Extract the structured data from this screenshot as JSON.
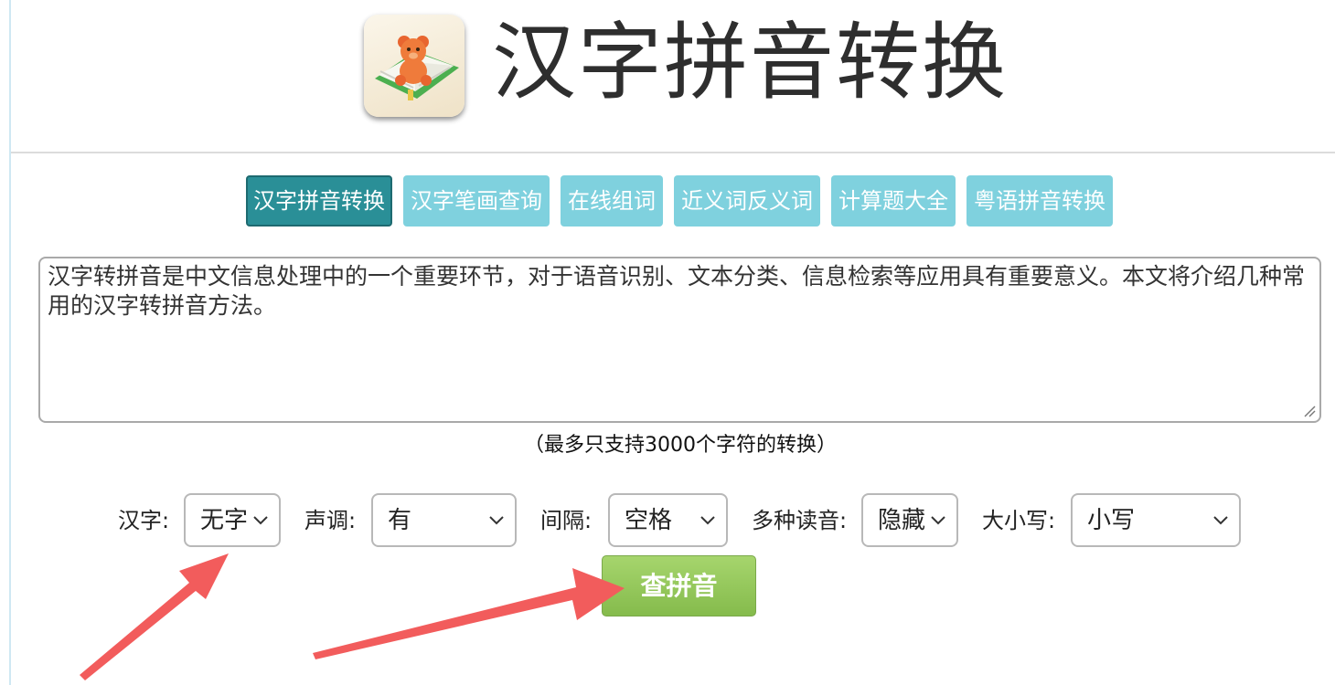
{
  "header": {
    "title": "汉字拼音转换",
    "logo_icon": "teddy-bear-book-logo"
  },
  "nav": {
    "items": [
      {
        "label": "汉字拼音转换",
        "active": true
      },
      {
        "label": "汉字笔画查询",
        "active": false
      },
      {
        "label": "在线组词",
        "active": false
      },
      {
        "label": "近义词反义词",
        "active": false
      },
      {
        "label": "计算题大全",
        "active": false
      },
      {
        "label": "粤语拼音转换",
        "active": false
      }
    ]
  },
  "input": {
    "value": "汉字转拼音是中文信息处理中的一个重要环节，对于语音识别、文本分类、信息检索等应用具有重要意义。本文将介绍几种常用的汉字转拼音方法。"
  },
  "hint": "（最多只支持3000个字符的转换）",
  "options": {
    "hanzi": {
      "label": "汉字:",
      "value": "无字"
    },
    "tone": {
      "label": "声调:",
      "value": "有"
    },
    "separator": {
      "label": "间隔:",
      "value": "空格"
    },
    "polyphone": {
      "label": "多种读音:",
      "value": "隐藏"
    },
    "case": {
      "label": "大小写:",
      "value": "小写"
    }
  },
  "submit_label": "查拼音",
  "colors": {
    "nav_active": "#2a8f97",
    "nav_inactive": "#7fd1de",
    "submit": "#95c75c",
    "annotation_arrow": "#f25c5c"
  }
}
